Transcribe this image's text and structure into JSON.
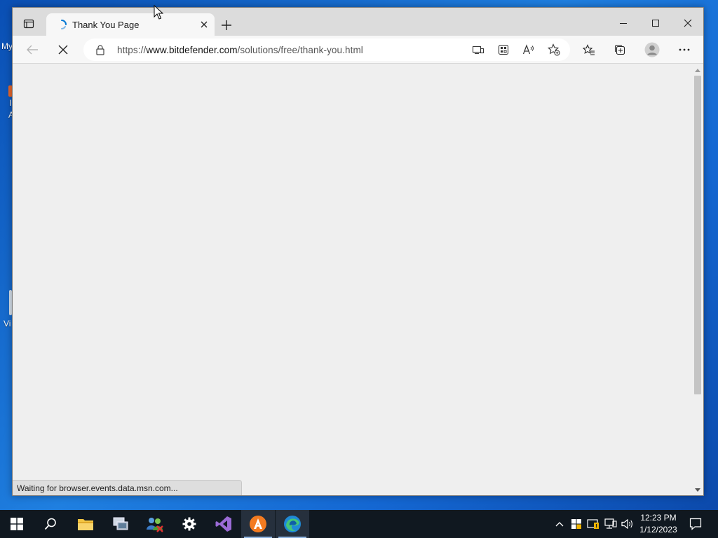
{
  "desktop": {
    "fragments": [
      "My",
      "I",
      "A",
      "Vi"
    ]
  },
  "browser": {
    "tab": {
      "title": "Thank You Page"
    },
    "address_bar": {
      "prefix": "https://",
      "domain": "www.bitdefender.com",
      "path": "/solutions/free/thank-you.html"
    },
    "status_text": "Waiting for browser.events.data.msn.com...",
    "accent": "#0078d4"
  },
  "taskbar": {
    "apps": [
      "start",
      "search",
      "file-explorer",
      "network-utility",
      "people-app",
      "settings",
      "visual-studio",
      "avast",
      "edge"
    ],
    "clock": {
      "time": "12:23 PM",
      "date": "1/12/2023"
    }
  }
}
